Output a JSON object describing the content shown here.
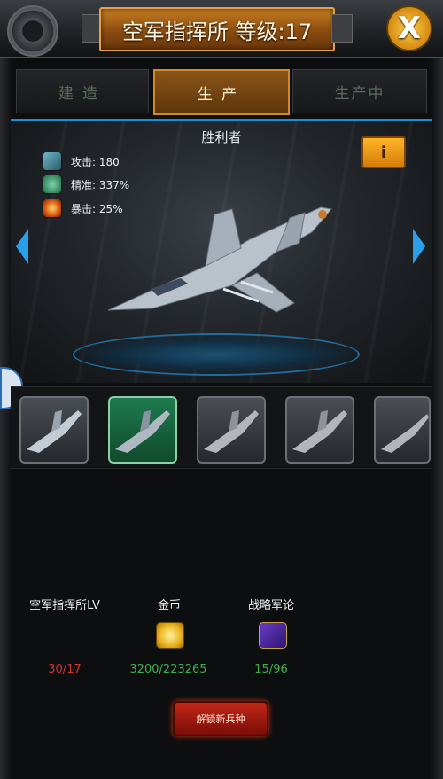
{
  "header": {
    "title": "空军指挥所 等级:17",
    "close_label": "X"
  },
  "tabs": [
    {
      "label": "建造",
      "active": false
    },
    {
      "label": "生产",
      "active": true
    },
    {
      "label": "生产中",
      "active": false
    }
  ],
  "unit": {
    "name": "胜利者",
    "info_label": "i",
    "stats": [
      {
        "icon": "missile-icon",
        "label": "攻击: 180"
      },
      {
        "icon": "crosshair-icon",
        "label": "精准: 337%"
      },
      {
        "icon": "explosion-icon",
        "label": "暴击: 25%"
      }
    ]
  },
  "thumbnails": [
    {
      "icon": "jet-icon",
      "selected": false
    },
    {
      "icon": "jet-icon",
      "selected": true
    },
    {
      "icon": "jet-icon",
      "selected": false
    },
    {
      "icon": "jet-icon",
      "selected": false
    },
    {
      "icon": "jet-icon",
      "selected": false
    }
  ],
  "requirements": {
    "command_level": {
      "label": "空军指挥所LV",
      "value": "30/17",
      "color": "#d2382a"
    },
    "gold": {
      "label": "金币",
      "icon": "gold-coin-icon",
      "value": "3200/223265",
      "color": "#3fb04a"
    },
    "strategy": {
      "label": "战略军论",
      "icon": "strategy-book-icon",
      "value": "15/96",
      "color": "#3fb04a"
    }
  },
  "unlock_button": {
    "label": "解锁新兵种"
  },
  "colors": {
    "accent_orange": "#c77d22",
    "accent_blue": "#2a9fe8",
    "panel_dark": "#0d0e10"
  }
}
